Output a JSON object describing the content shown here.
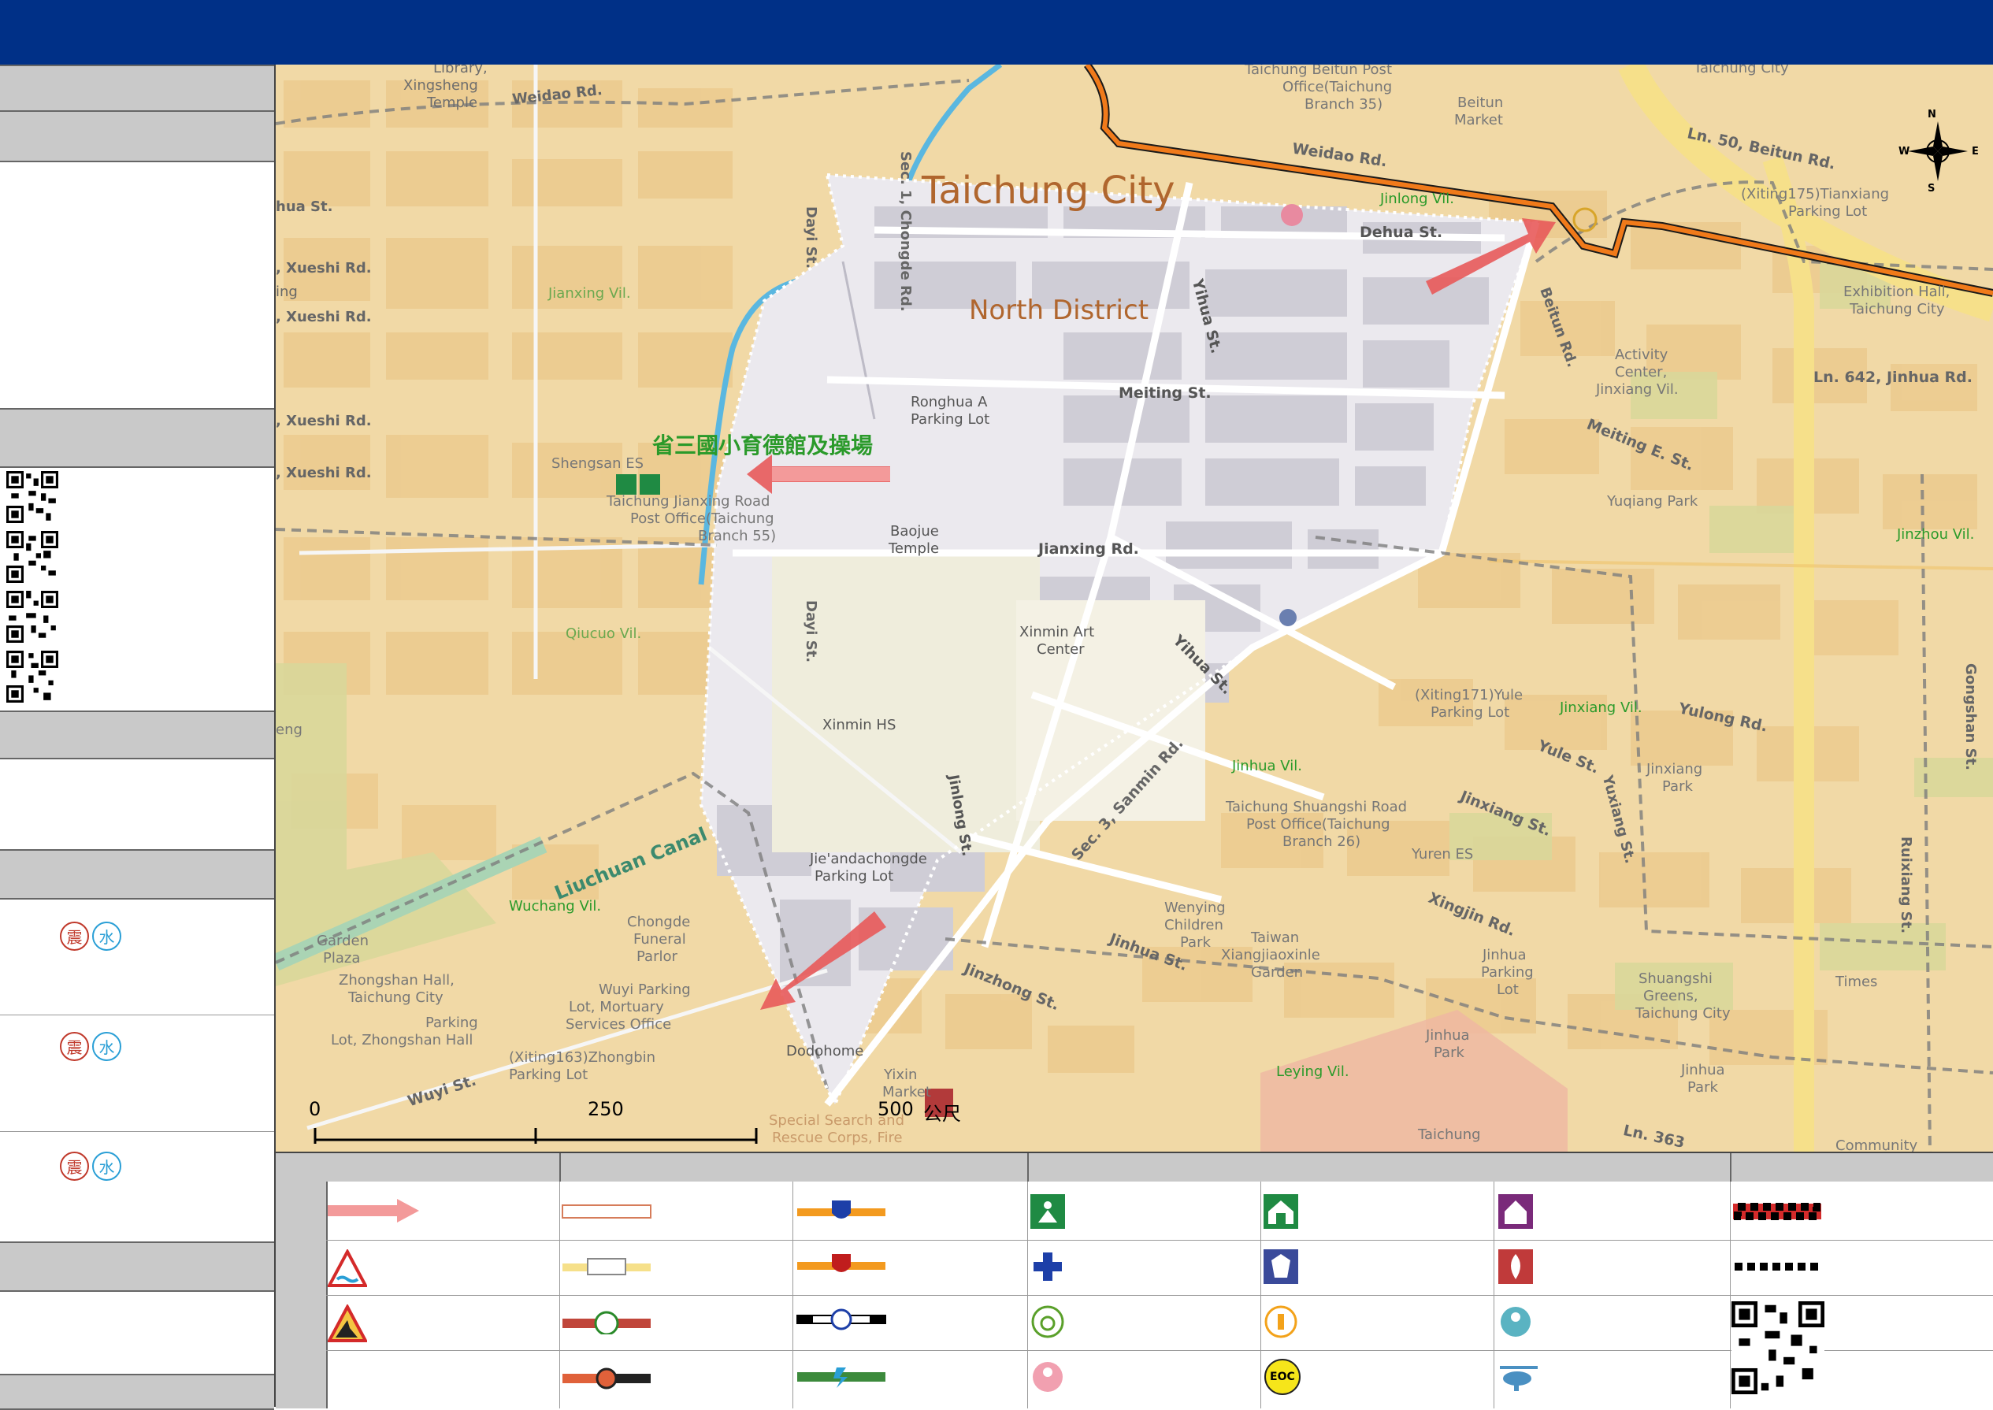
{
  "colors": {
    "header_bar": "#003087",
    "panel_gray": "#c9c9c9",
    "map_base": "#f1d9a6",
    "focus_area": "#e9e7ee",
    "district_boundary": "#f07a1a",
    "canal": "#5ab7e0",
    "arrow_red": "#e74c4c",
    "shelter_green": "#1f8a43",
    "quake_red": "#c0392b",
    "water_blue": "#2a9fd6"
  },
  "sidebar": {
    "hazard_rows": [
      {
        "quake_icon": "震",
        "water_icon": "水"
      },
      {
        "quake_icon": "震",
        "water_icon": "水"
      },
      {
        "quake_icon": "震",
        "water_icon": "水"
      }
    ]
  },
  "map": {
    "city_name": "Taichung City",
    "district_name": "North District",
    "shelter_callout": "省三國小育德館及操場",
    "compass": {
      "n": "N",
      "s": "S",
      "e": "E",
      "w": "W"
    },
    "scale": {
      "t0": "0",
      "t1": "250",
      "t2": "500",
      "unit": "公尺"
    },
    "labels": {
      "library": "Library,",
      "xingsheng": "Xingsheng",
      "temple": "Temple",
      "weidao_rd_w": "Weidao Rd.",
      "chongde_rd": "Sec. 1, Chongde Rd.",
      "dayi_st_n": "Dayi St.",
      "dayi_st_s": "Dayi St.",
      "hua_st": "hua St.",
      "xueshi_1": ", Xueshi Rd.",
      "xueshi_2": ", Xueshi Rd.",
      "xueshi_3": ", Xueshi Rd.",
      "xueshi_4": ", Xueshi Rd.",
      "ing": "ing",
      "jianxing_vil": "Jianxing Vil.",
      "shengsan_es": "Shengsan ES",
      "post_office_55_a": "Taichung Jianxing Road",
      "post_office_55_b": "Post Office(Taichung",
      "post_office_55_c": "Branch 55)",
      "ronghua_a": "Ronghua A",
      "ronghua_b": "Parking Lot",
      "baojue_a": "Baojue",
      "baojue_b": "Temple",
      "jianxing_rd": "Jianxing Rd.",
      "meiting_st": "Meiting St.",
      "yihua_st_n": "Yihua St.",
      "yihua_st_s": "Yihua St.",
      "dehua_st": "Dehua St.",
      "jinlong_vil": "Jinlong Vil.",
      "weidao_rd_e": "Weidao Rd.",
      "beitun_post_a": "Taichung Beitun Post",
      "beitun_post_b": "Office(Taichung",
      "beitun_post_c": "Branch 35)",
      "beitun_market_a": "Beitun",
      "beitun_market_b": "Market",
      "taichung_city_top": "Taichung City",
      "ln50": "Ln. 50, Beitun Rd.",
      "xiting175_a": "(Xiting175)Tianxiang",
      "xiting175_b": "Parking Lot",
      "exhibition_a": "Exhibition Hall,",
      "exhibition_b": "Taichung City",
      "beitun_rd": "Beitun Rd.",
      "activity_a": "Activity",
      "activity_b": "Center,",
      "activity_c": "Jinxiang Vil.",
      "ln642": "Ln. 642, Jinhua Rd.",
      "meiting_e": "Meiting E. St.",
      "yuqiang_park": "Yuqiang Park",
      "jinzhou_vil": "Jinzhou Vil.",
      "xinmin_art_a": "Xinmin Art",
      "xinmin_art_b": "Center",
      "qiucuo_vil": "Qiucuo Vil.",
      "xinmin_hs": "Xinmin HS",
      "eng": "eng",
      "jinlong_st": "Jinlong St.",
      "sanmin_rd": "Sec. 3, Sanmin Rd.",
      "xiting171_a": "(Xiting171)Yule",
      "xiting171_b": "Parking Lot",
      "jinxiang_vil": "Jinxiang Vil.",
      "yulong_rd": "Yulong Rd.",
      "yule_st": "Yule St.",
      "jinxiang_park_a": "Jinxiang",
      "jinxiang_park_b": "Park",
      "jinhua_vil": "Jinhua Vil.",
      "shuangshi_a": "Taichung Shuangshi Road",
      "shuangshi_b": "Post Office(Taichung",
      "shuangshi_c": "Branch 26)",
      "jinxiang_st": "Jinxiang St.",
      "yuren_es": "Yuren ES",
      "yuxiang_st": "Yuxiang St.",
      "ruixiang_st": "Ruixiang St.",
      "liuchuan": "Liuchuan Canal",
      "wuchang_vil": "Wuchang Vil.",
      "jieanda_a": "Jie'andachongde",
      "jieanda_b": "Parking Lot",
      "chongde_funeral_a": "Chongde",
      "chongde_funeral_b": "Funeral",
      "chongde_funeral_c": "Parlor",
      "garden_a": "Garden",
      "garden_b": "Plaza",
      "zhongshan_hall_a": "Zhongshan Hall,",
      "zhongshan_hall_b": "Taichung City",
      "zhongshan_parking_a": "Parking",
      "zhongshan_parking_b": "Lot, Zhongshan Hall",
      "wuyi_a": "Wuyi Parking",
      "wuyi_b": "Lot, Mortuary",
      "wuyi_c": "Services Office",
      "xiting163_a": "(Xiting163)Zhongbin",
      "xiting163_b": "Parking Lot",
      "wuyi_st": "Wuyi St.",
      "dodohome": "Dodohome",
      "yixin_a": "Yixin",
      "yixin_b": "Market",
      "special_a": "Special Search and",
      "special_b": "Rescue Corps, Fire",
      "wenying_a": "Wenying",
      "wenying_b": "Children",
      "wenying_c": "Park",
      "xiangjiao_a": "Taiwan",
      "xiangjiao_b": "Xiangjiaoxinle",
      "xiangjiao_c": "Garden",
      "jinhua_st": "Jinhua St.",
      "jinzhong_st": "Jinzhong St.",
      "xingjin_rd": "Xingjin Rd.",
      "jinhua_parking_a": "Jinhua",
      "jinhua_parking_b": "Parking",
      "jinhua_parking_c": "Lot",
      "jinhua_park_a": "Jinhua",
      "jinhua_park_b": "Park",
      "jinhua_park2_a": "Jinhua",
      "jinhua_park2_b": "Park",
      "shuangshi_greens_a": "Shuangshi",
      "shuangshi_greens_b": "Greens,",
      "shuangshi_greens_c": "Taichung City",
      "times": "Times",
      "leying_vil": "Leying Vil.",
      "taichung_bottom": "Taichung",
      "ln363": "Ln. 363",
      "community": "Community",
      "gongshan": "Gongshan St."
    }
  },
  "legend": {
    "eoc_label": "EOC"
  }
}
